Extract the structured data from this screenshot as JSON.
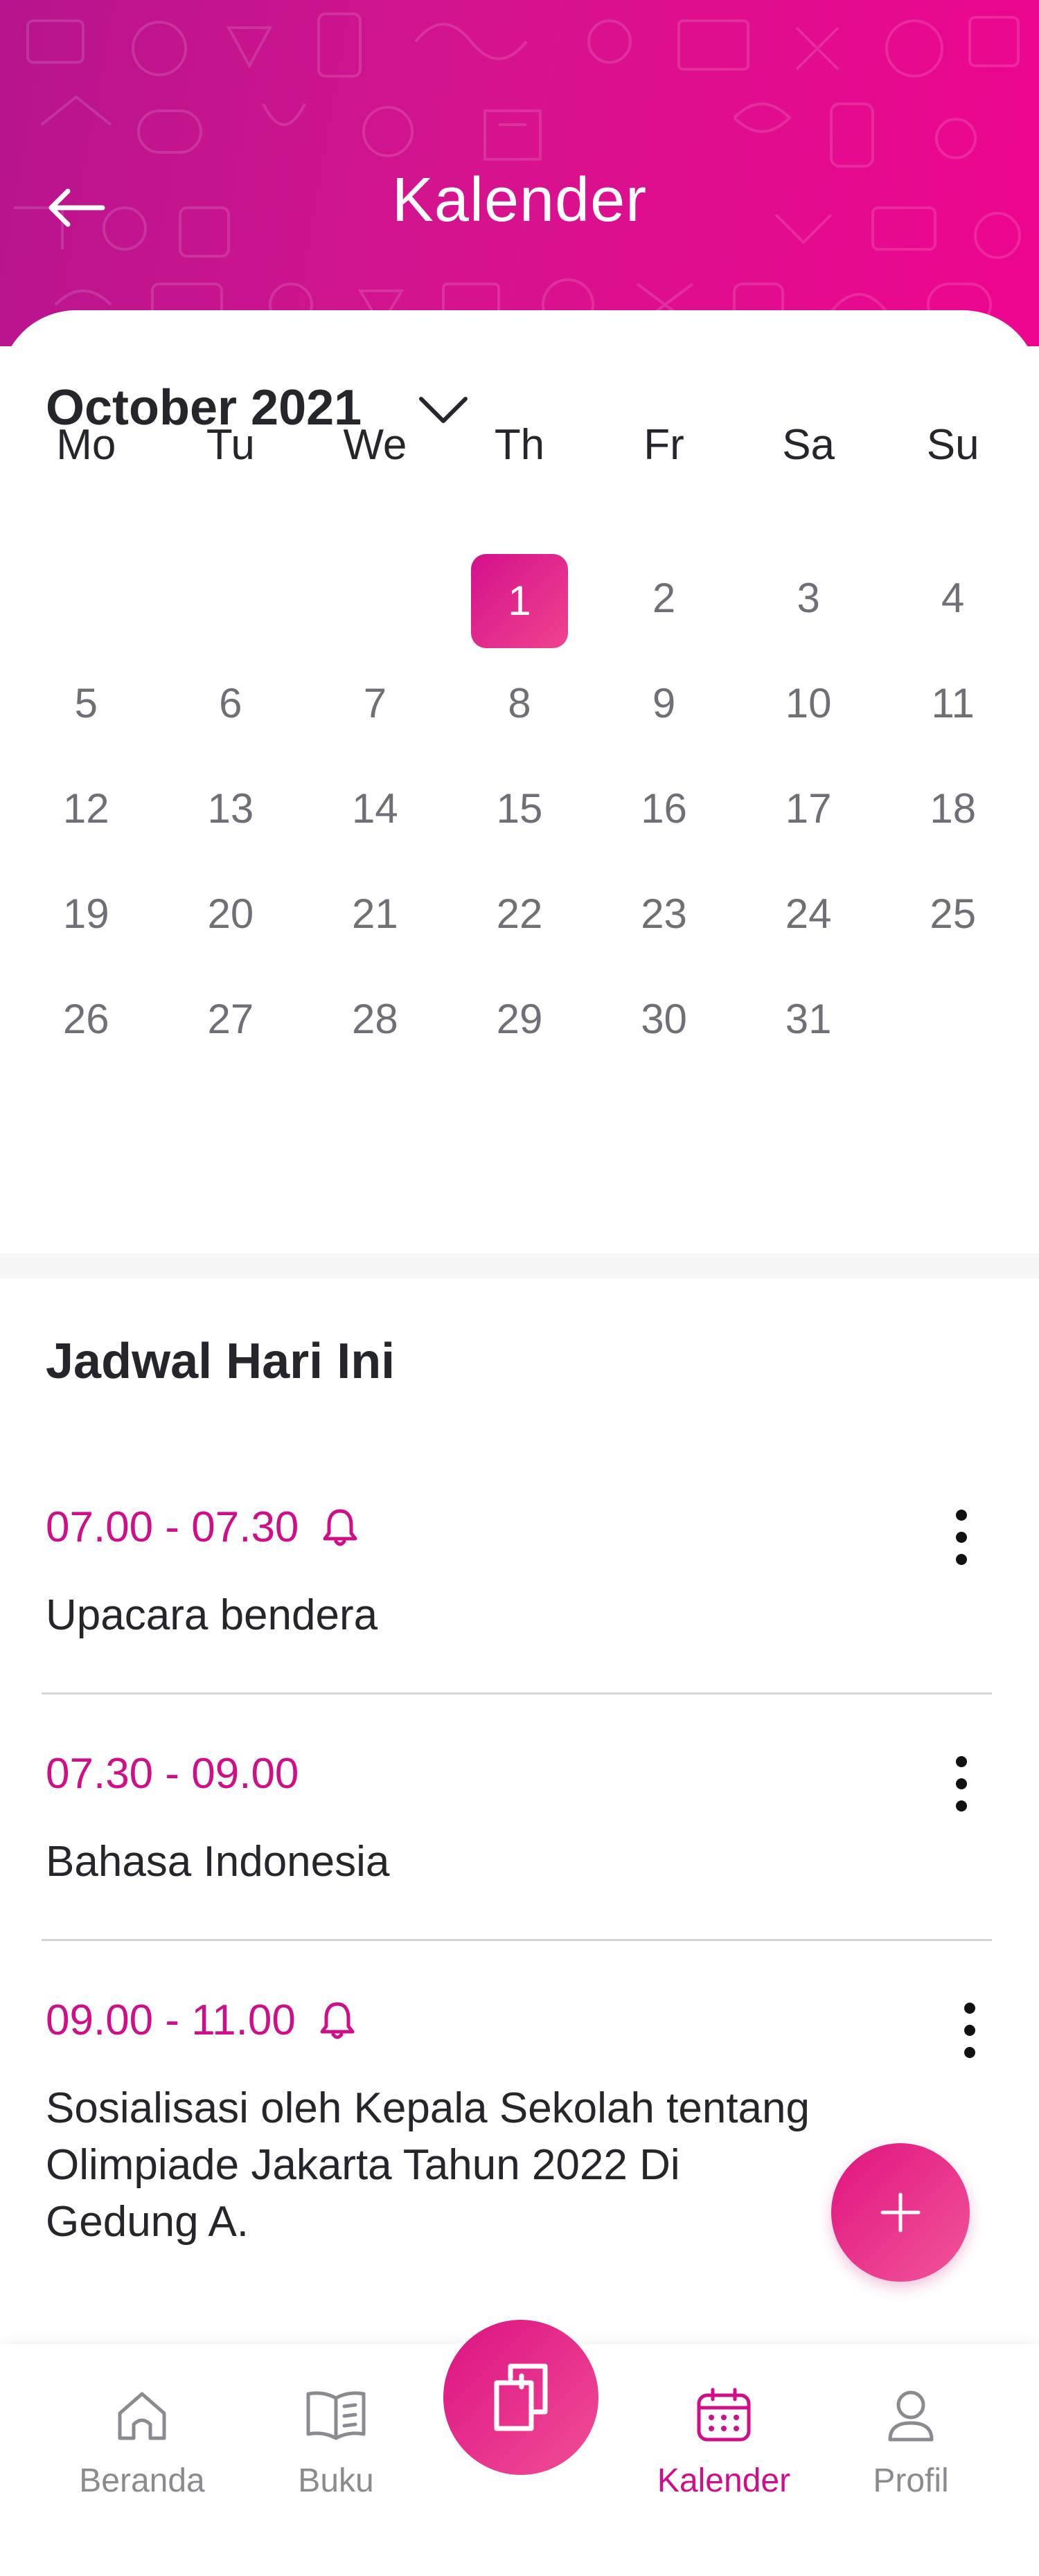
{
  "header": {
    "title": "Kalender"
  },
  "calendar": {
    "month_label": "October 2021",
    "weekdays": [
      "Mo",
      "Tu",
      "We",
      "Th",
      "Fr",
      "Sa",
      "Su"
    ],
    "weeks": [
      [
        "",
        "",
        "",
        "1",
        "2",
        "3",
        "4"
      ],
      [
        "5",
        "6",
        "7",
        "8",
        "9",
        "10",
        "11"
      ],
      [
        "12",
        "13",
        "14",
        "15",
        "16",
        "17",
        "18"
      ],
      [
        "19",
        "20",
        "21",
        "22",
        "23",
        "24",
        "25"
      ],
      [
        "26",
        "27",
        "28",
        "29",
        "30",
        "31",
        ""
      ]
    ],
    "selected_day": "1",
    "accent_color": "#cf0f88"
  },
  "schedule": {
    "title": "Jadwal Hari Ini",
    "items": [
      {
        "time": "07.00 - 07.30",
        "has_reminder": true,
        "title": "Upacara bendera"
      },
      {
        "time": "07.30 - 09.00",
        "has_reminder": false,
        "title": "Bahasa Indonesia"
      },
      {
        "time": "09.00 - 11.00",
        "has_reminder": true,
        "title": "Sosialisasi oleh Kepala Sekolah tentang Olimpiade Jakarta Tahun 2022 Di Gedung A."
      }
    ]
  },
  "bottom_nav": {
    "items": [
      {
        "label": "Beranda",
        "icon": "home-icon",
        "active": false
      },
      {
        "label": "Buku",
        "icon": "book-icon",
        "active": false
      },
      {
        "label": "Kalender",
        "icon": "calendar-icon",
        "active": true
      },
      {
        "label": "Profil",
        "icon": "user-icon",
        "active": false
      }
    ],
    "center_icon": "pages-icon"
  }
}
